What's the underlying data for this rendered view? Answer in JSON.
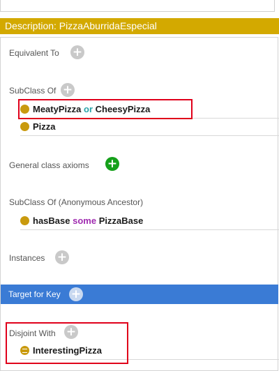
{
  "description_header": "Description: PizzaAburridaEspecial",
  "sections": {
    "equivalent_to": "Equivalent To",
    "subclass_of": "SubClass Of",
    "general_class_axioms": "General class axioms",
    "subclass_anonymous": "SubClass Of (Anonymous Ancestor)",
    "instances": "Instances",
    "target_for_key": "Target for Key",
    "disjoint_with": "Disjoint With"
  },
  "subclass_axioms": {
    "first_left": "MeatyPizza",
    "first_op": "or",
    "first_right": "CheesyPizza",
    "second": "Pizza"
  },
  "anonymous_axiom": {
    "left": "hasBase",
    "op": "some",
    "right": "PizzaBase"
  },
  "disjoint_axiom": "InterestingPizza",
  "colors": {
    "header_bg": "#d3a900",
    "selected_section_bg": "#3a7bd5",
    "highlight_box": "#e0001a",
    "class_dot": "#c99a0e",
    "add_green": "#15a01a"
  },
  "icons": [
    "add-icon",
    "class-dot-icon",
    "equivalent-class-icon"
  ]
}
